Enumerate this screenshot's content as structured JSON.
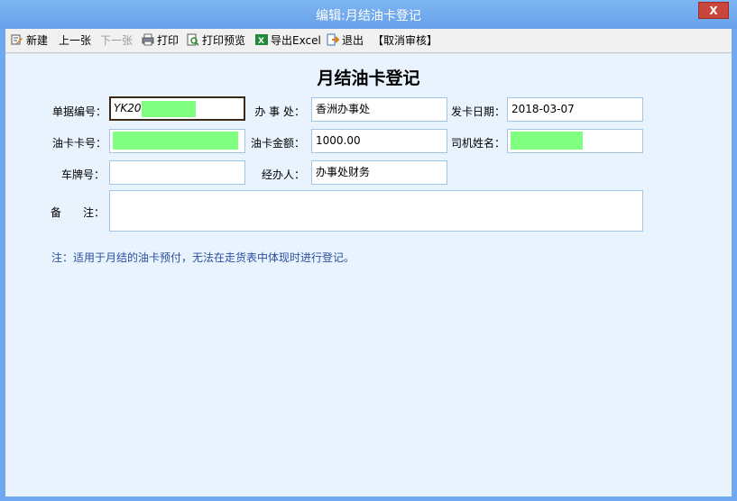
{
  "window": {
    "title": "编辑:月结油卡登记",
    "close_label": "X"
  },
  "toolbar": {
    "items": [
      {
        "label": "新建",
        "icon": "edit-icon"
      },
      {
        "label": "上一张"
      },
      {
        "label": "下一张",
        "disabled": true
      },
      {
        "label": "打印",
        "icon": "printer-icon"
      },
      {
        "label": "打印预览",
        "icon": "print-preview-icon"
      },
      {
        "label": "导出Excel",
        "icon": "excel-icon"
      },
      {
        "label": "退出",
        "icon": "exit-icon"
      },
      {
        "label": "【取消审核】"
      }
    ]
  },
  "form": {
    "title": "月结油卡登记",
    "doc_no": {
      "label": "单据编号：",
      "value": "YK20"
    },
    "office": {
      "label": "办 事 处：",
      "value": "香洲办事处"
    },
    "issue_date": {
      "label": "发卡日期：",
      "value": "2018-03-07"
    },
    "card_no": {
      "label": "油卡卡号：",
      "value": ""
    },
    "amount": {
      "label": "油卡金额：",
      "value": "1000.00"
    },
    "driver": {
      "label": "司机姓名：",
      "value": ""
    },
    "plate": {
      "label": "车牌号：",
      "value": ""
    },
    "handler": {
      "label": "经办人：",
      "value": "办事处财务"
    },
    "remark": {
      "label": "备　　注：",
      "value": ""
    }
  },
  "note": "注：适用于月结的油卡预付，无法在走货表中体现时进行登记。",
  "colors": {
    "accent": "#6fa8ee",
    "content_bg": "#e9f3fd",
    "field_border": "#9fc5e8",
    "redaction": "#80ff80",
    "note_text": "#2b4fa0"
  }
}
